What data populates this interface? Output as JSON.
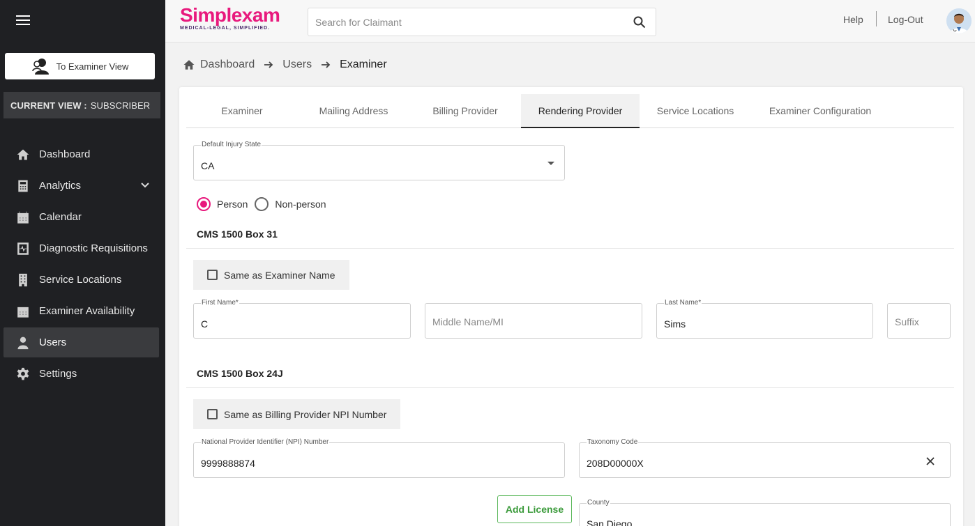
{
  "sidebar": {
    "examiner_button": "To Examiner View",
    "current_view_label": "CURRENT VIEW :",
    "current_view_value": "SUBSCRIBER",
    "items": [
      {
        "label": "Dashboard",
        "icon": "home-icon"
      },
      {
        "label": "Analytics",
        "icon": "calculator-icon"
      },
      {
        "label": "Calendar",
        "icon": "calendar-icon"
      },
      {
        "label": "Diagnostic Requisitions",
        "icon": "requisition-icon"
      },
      {
        "label": "Service Locations",
        "icon": "building-icon"
      },
      {
        "label": "Examiner Availability",
        "icon": "calendar-check-icon"
      },
      {
        "label": "Users",
        "icon": "user-icon",
        "active": true
      },
      {
        "label": "Settings",
        "icon": "gear-icon"
      }
    ]
  },
  "header": {
    "logo_word": "Simplexam",
    "logo_tagline": "MEDICAL-LEGAL, SIMPLIFIED.",
    "search_placeholder": "Search for Claimant",
    "help": "Help",
    "logout": "Log-Out"
  },
  "breadcrumb": {
    "items": [
      "Dashboard",
      "Users",
      "Examiner"
    ]
  },
  "tabs": [
    {
      "label": "Examiner"
    },
    {
      "label": "Mailing Address"
    },
    {
      "label": "Billing Provider"
    },
    {
      "label": "Rendering Provider",
      "active": true
    },
    {
      "label": "Service Locations"
    },
    {
      "label": "Examiner Configuration"
    }
  ],
  "form": {
    "injury_state_label": "Default Injury State",
    "injury_state_value": "CA",
    "radio_person": "Person",
    "radio_nonperson": "Non-person",
    "box31_title": "CMS 1500 Box 31",
    "same_examiner_label": "Same as Examiner Name",
    "first_name_label": "First Name*",
    "first_name_value": "C",
    "middle_name_placeholder": "Middle Name/MI",
    "last_name_label": "Last Name*",
    "last_name_value": "Sims",
    "suffix_placeholder": "Suffix",
    "box24j_title": "CMS 1500 Box 24J",
    "same_billing_label": "Same as Billing Provider NPI Number",
    "npi_label": "National Provider Identifier (NPI) Number",
    "npi_value": "9999888874",
    "taxonomy_label": "Taxonomy Code",
    "taxonomy_value": "208D00000X",
    "add_license": "Add License",
    "county_label": "County",
    "county_value": "San Diego"
  },
  "colors": {
    "accent": "#e8197d",
    "sidebar_bg": "#1f2023",
    "add_license_green": "#3a9a3a"
  }
}
